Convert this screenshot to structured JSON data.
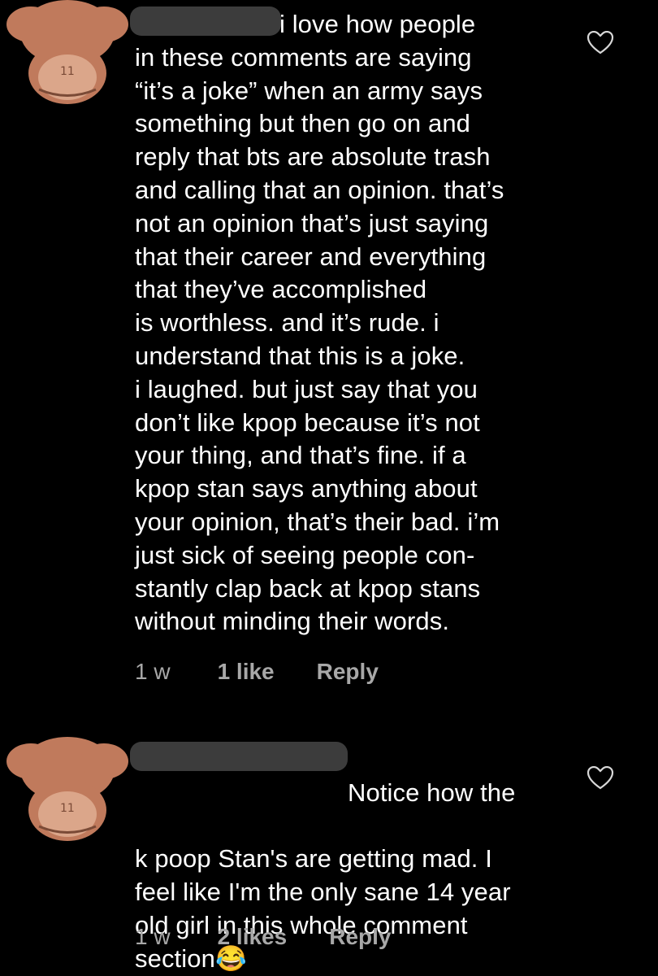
{
  "comments": [
    {
      "text": "i love how people\nin these comments are saying\n“it’s a joke” when an army says\nsomething but then go on and\nreply that bts are absolute trash\nand calling that an opinion. that’s\nnot an opinion that’s just saying\nthat their career and everything\nthat they’ve accomplished\nis worthless. and it’s rude. i\nunderstand that this is a joke.\ni laughed. but just say that you\ndon’t like kpop because it’s not\nyour thing, and that’s fine. if a\nkpop stan says anything about\nyour opinion, that’s their bad. i’m\njust sick of seeing people con-\nstantly clap back at kpop stans\nwithout minding their words.",
      "time": "1 w",
      "likes": "1 like",
      "reply": "Reply",
      "avatar_icon": "see-no-evil-monkey-icon"
    },
    {
      "text_first": "Notice how the",
      "text_rest": "k poop Stan's are getting mad. I\nfeel like I'm the only sane 14 year\nold girl in this whole comment\nsection",
      "emoji": "😂",
      "time": "1 w",
      "likes": "2 likes",
      "reply": "Reply",
      "avatar_icon": "see-no-evil-monkey-icon"
    }
  ],
  "colors": {
    "background": "#000000",
    "text": "#ffffff",
    "meta": "#a8a8a8",
    "avatar": "#c07a5c",
    "redaction": "#3c3c3c"
  }
}
